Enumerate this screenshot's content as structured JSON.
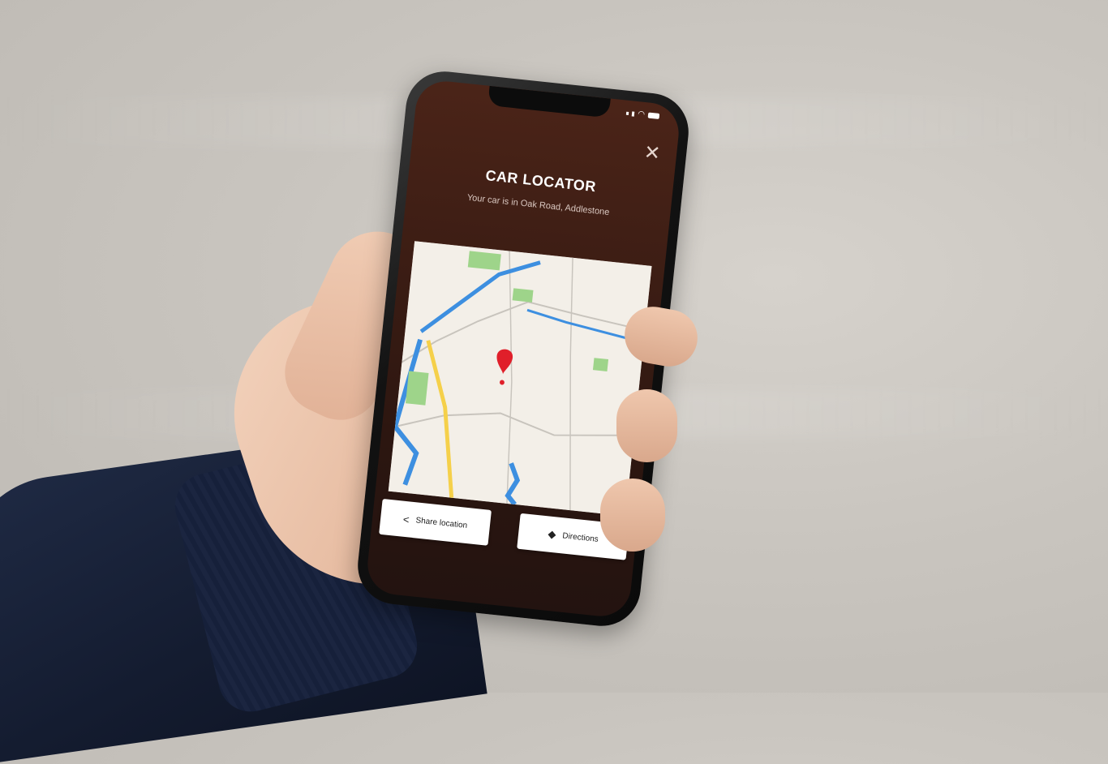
{
  "app": {
    "title": "CAR LOCATOR",
    "subtitle": "Your car is in Oak Road, Addlestone"
  },
  "buttons": {
    "share_label": "Share location",
    "directions_label": "Directions"
  },
  "icons": {
    "close": "close-icon",
    "share": "share-icon",
    "directions": "directions-icon",
    "pin": "map-pin-icon"
  },
  "colors": {
    "header_bg": "#4b2418",
    "pin": "#e01f2a",
    "water": "#3d8fe0",
    "park": "#9ed48a",
    "road": "#f5d04a"
  }
}
